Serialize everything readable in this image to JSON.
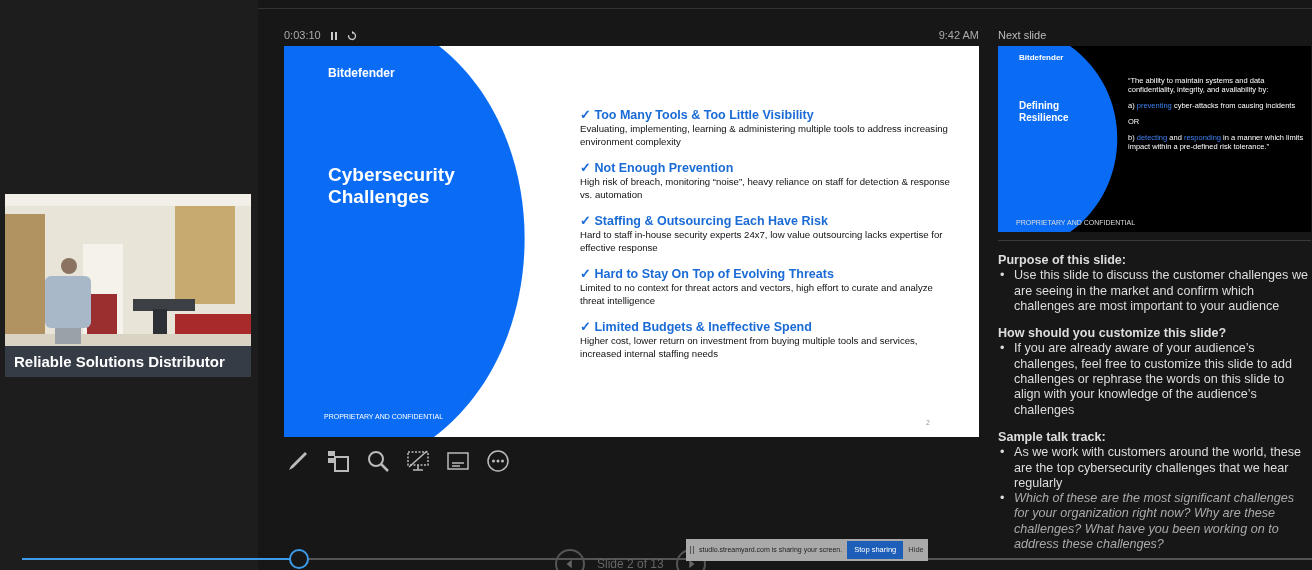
{
  "video": {
    "caption": "Reliable Solutions Distributor"
  },
  "presenter": {
    "timer": "0:03:10",
    "clock": "9:42 AM"
  },
  "current_slide": {
    "logo": "Bitdefender",
    "title": "Cybersecurity Challenges",
    "items": [
      {
        "heading": "✓ Too Many Tools & Too Little Visibility",
        "body": "Evaluating, implementing, learning & administering multiple tools to address increasing environment complexity"
      },
      {
        "heading": "✓ Not Enough Prevention",
        "body": "High risk of breach, monitoring “noise”, heavy reliance on staff for detection & response vs. automation"
      },
      {
        "heading": "✓ Staffing & Outsourcing Each Have Risk",
        "body": "Hard to staff in-house security experts 24x7, low value outsourcing lacks expertise for effective response"
      },
      {
        "heading": "✓ Hard to Stay On Top of Evolving Threats",
        "body": "Limited to no context for threat actors and vectors, high effort to curate and analyze threat intelligence"
      },
      {
        "heading": "✓ Limited Budgets & Ineffective Spend",
        "body": "Higher cost, lower return on investment from buying multiple tools and services, increased internal staffing needs"
      }
    ],
    "footer": "PROPRIETARY AND CONFIDENTIAL",
    "page_number": "2"
  },
  "next_slide": {
    "label": "Next slide",
    "logo": "Bitdefender",
    "title": "Defining Resilience",
    "paragraphs": [
      [
        {
          "text": "“The ability to maintain systems and data confidentiality, integrity, and availability by:",
          "highlight": false
        }
      ],
      [
        {
          "text": "a) ",
          "highlight": false
        },
        {
          "text": "preventing",
          "highlight": true
        },
        {
          "text": " cyber-attacks from causing incidents",
          "highlight": false
        }
      ],
      [
        {
          "text": "OR",
          "highlight": false
        }
      ],
      [
        {
          "text": "b) ",
          "highlight": false
        },
        {
          "text": "detecting",
          "highlight": true
        },
        {
          "text": " and ",
          "highlight": false
        },
        {
          "text": "responding",
          "highlight": true
        },
        {
          "text": " in a manner which limits impact within a pre-defined risk tolerance.”",
          "highlight": false
        }
      ]
    ],
    "footer": "PROPRIETARY AND CONFIDENTIAL"
  },
  "notes": [
    {
      "heading": "Purpose of this slide:",
      "bullets": [
        {
          "marker": "•",
          "text": "Use this slide to discuss the customer challenges we are seeing in the market and confirm which challenges are most important to your audience",
          "italic": false
        }
      ]
    },
    {
      "heading": "How should you customize this slide?",
      "bullets": [
        {
          "marker": "•",
          "text": "If you are already aware of your audience’s challenges, feel free to customize this slide to add challenges or rephrase the words on this slide to align with your knowledge of the audience’s challenges",
          "italic": false
        }
      ]
    },
    {
      "heading": "Sample talk track:",
      "bullets": [
        {
          "marker": "•",
          "text": "As we work with customers around the world, these are the top cybersecurity challenges that we hear regularly",
          "italic": false
        },
        {
          "marker": "•",
          "text": "Which of these are the most significant challenges for your organization right now? Why are these challenges? What have you been working on to address these challenges?",
          "italic": true
        }
      ]
    }
  ],
  "navigation": {
    "slide_counter": "Slide 2 of 13"
  },
  "progress": {
    "level": 0.215
  },
  "share_bar": {
    "message": "studio.streamyard.com is sharing your screen.",
    "stop_button": "Stop sharing",
    "hide_button": "Hide"
  }
}
